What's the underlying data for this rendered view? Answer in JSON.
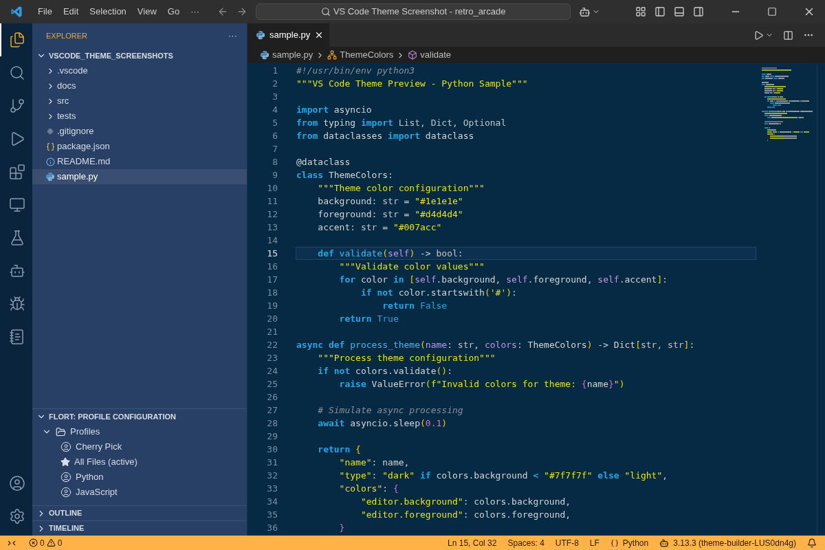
{
  "title_bar": {
    "menu": [
      "File",
      "Edit",
      "Selection",
      "View",
      "Go",
      "···"
    ],
    "search": "VS Code Theme Screenshot - retro_arcade"
  },
  "activity_bar": {
    "top": [
      {
        "kind": "files",
        "selected": true
      },
      {
        "kind": "search",
        "selected": false
      },
      {
        "kind": "source-control",
        "selected": false
      },
      {
        "kind": "run",
        "selected": false
      },
      {
        "kind": "extensions",
        "selected": false
      },
      {
        "kind": "remote",
        "selected": false
      },
      {
        "kind": "testing",
        "selected": false
      },
      {
        "kind": "alien",
        "selected": false
      },
      {
        "kind": "bug",
        "selected": false
      },
      {
        "kind": "notebook",
        "selected": false
      }
    ],
    "bottom": [
      {
        "kind": "account"
      },
      {
        "kind": "settings"
      }
    ]
  },
  "sidebar": {
    "title": "EXPLORER",
    "more": "···",
    "folder": {
      "name": "VSCODE_THEME_SCREENSHOTS",
      "expanded": true,
      "items": [
        {
          "name": ".vscode",
          "kind": "folder",
          "expanded": false,
          "selected": false
        },
        {
          "name": "docs",
          "kind": "folder",
          "expanded": false,
          "selected": false
        },
        {
          "name": "src",
          "kind": "folder",
          "expanded": false,
          "selected": false
        },
        {
          "name": "tests",
          "kind": "folder",
          "expanded": false,
          "selected": false
        },
        {
          "name": ".gitignore",
          "kind": "gitignore",
          "selected": false
        },
        {
          "name": "package.json",
          "kind": "json",
          "selected": false
        },
        {
          "name": "README.md",
          "kind": "info",
          "selected": false
        },
        {
          "name": "sample.py",
          "kind": "python",
          "selected": true
        }
      ]
    },
    "profiles": {
      "title": "FLORT: PROFILE CONFIGURATION",
      "expanded": true,
      "group": {
        "label": "Profiles",
        "expanded": true,
        "children": [
          {
            "label": "Cherry Pick",
            "kind": "profile"
          },
          {
            "label": "All Files (active)",
            "kind": "active"
          },
          {
            "label": "Python",
            "kind": "profile"
          },
          {
            "label": "JavaScript",
            "kind": "profile"
          }
        ]
      }
    },
    "sections": [
      {
        "title": "OUTLINE",
        "expanded": false
      },
      {
        "title": "TIMELINE",
        "expanded": false
      }
    ]
  },
  "editor": {
    "tabs": [
      {
        "label": "sample.py",
        "selected": true
      }
    ],
    "breadcrumbs": [
      {
        "label": "sample.py",
        "kind": "python"
      },
      {
        "label": "ThemeColors",
        "kind": "class"
      },
      {
        "label": "validate",
        "kind": "method"
      }
    ],
    "lines": [
      {
        "n": "1",
        "current": false,
        "tokens": [
          {
            "text": "#!/usr/bin/env python3",
            "kind": "cm"
          }
        ]
      },
      {
        "n": "2",
        "current": false,
        "tokens": [
          {
            "text": "\"\"\"VS Code Theme Preview - Python Sample\"\"\"",
            "kind": "str"
          }
        ]
      },
      {
        "n": "3",
        "current": false
      },
      {
        "n": "4",
        "current": false,
        "tokens": [
          {
            "text": "import",
            "kind": "kw"
          },
          {
            "text": " asyncio",
            "kind": "pl"
          }
        ]
      },
      {
        "n": "5",
        "current": false,
        "tokens": [
          {
            "text": "from",
            "kind": "kw"
          },
          {
            "text": " typing ",
            "kind": "pl"
          },
          {
            "text": "import",
            "kind": "kw"
          },
          {
            "text": " List, Dict, Optional",
            "kind": "ty"
          }
        ]
      },
      {
        "n": "6",
        "current": false,
        "tokens": [
          {
            "text": "from",
            "kind": "kw"
          },
          {
            "text": " dataclasses ",
            "kind": "pl"
          },
          {
            "text": "import",
            "kind": "kw"
          },
          {
            "text": " dataclass",
            "kind": "pl"
          }
        ]
      },
      {
        "n": "7",
        "current": false
      },
      {
        "n": "8",
        "current": false,
        "tokens": [
          {
            "text": "@dataclass",
            "kind": "pl"
          }
        ]
      },
      {
        "n": "9",
        "current": false,
        "tokens": [
          {
            "text": "class",
            "kind": "kw"
          },
          {
            "text": " ThemeColors:",
            "kind": "pl"
          }
        ]
      },
      {
        "n": "10",
        "current": false,
        "tokens": [
          {
            "text": "    \"\"\"Theme color configuration\"\"\"",
            "kind": "str"
          }
        ]
      },
      {
        "n": "11",
        "current": false,
        "tokens": [
          {
            "text": "    background: ",
            "kind": "pl"
          },
          {
            "text": "str",
            "kind": "ty"
          },
          {
            "text": " = ",
            "kind": "pl"
          },
          {
            "text": "\"#1e1e1e\"",
            "kind": "str"
          }
        ]
      },
      {
        "n": "12",
        "current": false,
        "tokens": [
          {
            "text": "    foreground: ",
            "kind": "pl"
          },
          {
            "text": "str",
            "kind": "ty"
          },
          {
            "text": " = ",
            "kind": "pl"
          },
          {
            "text": "\"#d4d4d4\"",
            "kind": "str"
          }
        ]
      },
      {
        "n": "13",
        "current": false,
        "tokens": [
          {
            "text": "    accent: ",
            "kind": "pl"
          },
          {
            "text": "str",
            "kind": "ty"
          },
          {
            "text": " = ",
            "kind": "pl"
          },
          {
            "text": "\"#007acc\"",
            "kind": "str"
          }
        ]
      },
      {
        "n": "14",
        "current": false
      },
      {
        "n": "15",
        "current": true,
        "tokens": [
          {
            "text": "    def",
            "kind": "kw"
          },
          {
            "text": " validate",
            "kind": "fn"
          },
          {
            "text": "(",
            "kind": "br"
          },
          {
            "text": "self",
            "kind": "self"
          },
          {
            "text": ")",
            "kind": "br"
          },
          {
            "text": " -> ",
            "kind": "pl"
          },
          {
            "text": "bool",
            "kind": "ty"
          },
          {
            "text": ":",
            "kind": "pl"
          }
        ]
      },
      {
        "n": "16",
        "current": false,
        "tokens": [
          {
            "text": "        \"\"\"Validate color values\"\"\"",
            "kind": "str"
          }
        ]
      },
      {
        "n": "17",
        "current": false,
        "tokens": [
          {
            "text": "        for",
            "kind": "kw"
          },
          {
            "text": " color ",
            "kind": "pl"
          },
          {
            "text": "in",
            "kind": "kw"
          },
          {
            "text": " [",
            "kind": "br"
          },
          {
            "text": "self",
            "kind": "self"
          },
          {
            "text": ".background, ",
            "kind": "pl"
          },
          {
            "text": "self",
            "kind": "self"
          },
          {
            "text": ".foreground, ",
            "kind": "pl"
          },
          {
            "text": "self",
            "kind": "self"
          },
          {
            "text": ".accent",
            "kind": "pl"
          },
          {
            "text": "]",
            "kind": "br"
          },
          {
            "text": ":",
            "kind": "pl"
          }
        ]
      },
      {
        "n": "18",
        "current": false,
        "tokens": [
          {
            "text": "            if not",
            "kind": "kw"
          },
          {
            "text": " color.startswith",
            "kind": "pl"
          },
          {
            "text": "(",
            "kind": "br"
          },
          {
            "text": "'#'",
            "kind": "str"
          },
          {
            "text": ")",
            "kind": "br"
          },
          {
            "text": ":",
            "kind": "pl"
          }
        ]
      },
      {
        "n": "19",
        "current": false,
        "tokens": [
          {
            "text": "                return",
            "kind": "kw"
          },
          {
            "text": " False",
            "kind": "const"
          }
        ]
      },
      {
        "n": "20",
        "current": false,
        "tokens": [
          {
            "text": "        return",
            "kind": "kw"
          },
          {
            "text": " True",
            "kind": "const"
          }
        ]
      },
      {
        "n": "21",
        "current": false
      },
      {
        "n": "22",
        "current": false,
        "tokens": [
          {
            "text": "async def",
            "kind": "kw"
          },
          {
            "text": " process_theme",
            "kind": "fn"
          },
          {
            "text": "(",
            "kind": "br"
          },
          {
            "text": "name",
            "kind": "self"
          },
          {
            "text": ": ",
            "kind": "pl"
          },
          {
            "text": "str",
            "kind": "ty"
          },
          {
            "text": ", ",
            "kind": "pl"
          },
          {
            "text": "colors",
            "kind": "self"
          },
          {
            "text": ": ThemeColors",
            "kind": "pl"
          },
          {
            "text": ")",
            "kind": "br"
          },
          {
            "text": " -> Dict",
            "kind": "pl"
          },
          {
            "text": "[",
            "kind": "br"
          },
          {
            "text": "str, str",
            "kind": "ty"
          },
          {
            "text": "]",
            "kind": "br"
          },
          {
            "text": ":",
            "kind": "pl"
          }
        ]
      },
      {
        "n": "23",
        "current": false,
        "tokens": [
          {
            "text": "    \"\"\"Process theme configuration\"\"\"",
            "kind": "str"
          }
        ]
      },
      {
        "n": "24",
        "current": false,
        "tokens": [
          {
            "text": "    if not",
            "kind": "kw"
          },
          {
            "text": " colors.validate",
            "kind": "pl"
          },
          {
            "text": "()",
            "kind": "br"
          },
          {
            "text": ":",
            "kind": "pl"
          }
        ]
      },
      {
        "n": "25",
        "current": false,
        "tokens": [
          {
            "text": "        raise",
            "kind": "kw"
          },
          {
            "text": " ValueError",
            "kind": "pl"
          },
          {
            "text": "(",
            "kind": "br"
          },
          {
            "text": "f\"Invalid colors for theme: ",
            "kind": "str"
          },
          {
            "text": "{",
            "kind": "br2"
          },
          {
            "text": "name",
            "kind": "pl"
          },
          {
            "text": "}",
            "kind": "br2"
          },
          {
            "text": "\"",
            "kind": "str"
          },
          {
            "text": ")",
            "kind": "br"
          }
        ]
      },
      {
        "n": "26",
        "current": false
      },
      {
        "n": "27",
        "current": false,
        "tokens": [
          {
            "text": "    # Simulate async processing",
            "kind": "cm"
          }
        ]
      },
      {
        "n": "28",
        "current": false,
        "tokens": [
          {
            "text": "    await",
            "kind": "kw"
          },
          {
            "text": " asyncio.sleep",
            "kind": "pl"
          },
          {
            "text": "(",
            "kind": "br"
          },
          {
            "text": "0.1",
            "kind": "num"
          },
          {
            "text": ")",
            "kind": "br"
          }
        ]
      },
      {
        "n": "29",
        "current": false
      },
      {
        "n": "30",
        "current": false,
        "tokens": [
          {
            "text": "    return",
            "kind": "kw"
          },
          {
            "text": " {",
            "kind": "br"
          }
        ]
      },
      {
        "n": "31",
        "current": false,
        "tokens": [
          {
            "text": "        \"name\"",
            "kind": "str"
          },
          {
            "text": ": name,",
            "kind": "pl"
          }
        ]
      },
      {
        "n": "32",
        "current": false,
        "tokens": [
          {
            "text": "        \"type\"",
            "kind": "str"
          },
          {
            "text": ": ",
            "kind": "pl"
          },
          {
            "text": "\"dark\"",
            "kind": "str"
          },
          {
            "text": " if",
            "kind": "kw"
          },
          {
            "text": " colors.background ",
            "kind": "pl"
          },
          {
            "text": "<",
            "kind": "kw"
          },
          {
            "text": " \"#7f7f7f\"",
            "kind": "str"
          },
          {
            "text": " else",
            "kind": "kw"
          },
          {
            "text": " \"light\"",
            "kind": "str"
          },
          {
            "text": ",",
            "kind": "pl"
          }
        ]
      },
      {
        "n": "33",
        "current": false,
        "tokens": [
          {
            "text": "        \"colors\"",
            "kind": "str"
          },
          {
            "text": ": ",
            "kind": "pl"
          },
          {
            "text": "{",
            "kind": "br2"
          }
        ]
      },
      {
        "n": "34",
        "current": false,
        "tokens": [
          {
            "text": "            \"editor.background\"",
            "kind": "str"
          },
          {
            "text": ": colors.background,",
            "kind": "pl"
          }
        ]
      },
      {
        "n": "35",
        "current": false,
        "tokens": [
          {
            "text": "            \"editor.foreground\"",
            "kind": "str"
          },
          {
            "text": ": colors.foreground,",
            "kind": "pl"
          }
        ]
      },
      {
        "n": "36",
        "current": false,
        "tokens": [
          {
            "text": "        }",
            "kind": "br2"
          }
        ]
      }
    ]
  },
  "status_bar": {
    "errors": "0",
    "warnings": "0",
    "items": [
      {
        "text": "Ln 15, Col 32",
        "kind": "text"
      },
      {
        "text": "Spaces: 4",
        "kind": "text"
      },
      {
        "text": "UTF-8",
        "kind": "text"
      },
      {
        "text": "LF",
        "kind": "text"
      },
      {
        "text": "Python",
        "kind": "language"
      },
      {
        "text": "3.13.3 (theme-builder-LUS0dn4g)",
        "kind": "copilot"
      }
    ]
  }
}
